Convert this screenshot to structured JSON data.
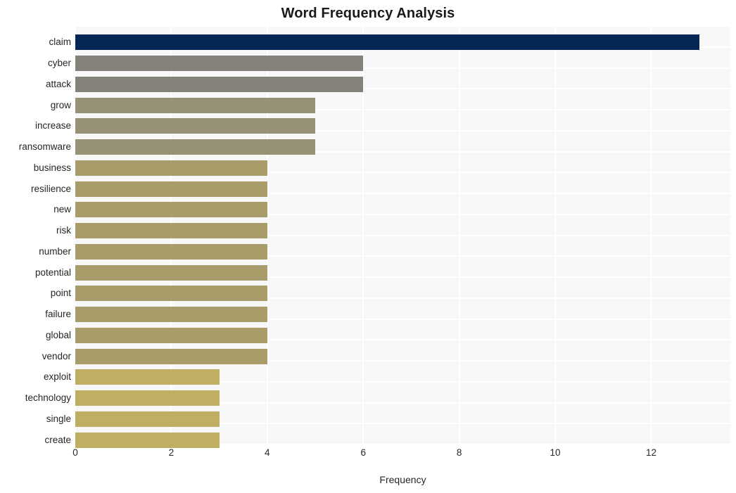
{
  "chart_data": {
    "type": "bar",
    "orientation": "horizontal",
    "title": "Word Frequency Analysis",
    "xlabel": "Frequency",
    "ylabel": "",
    "xlim": [
      0,
      13.65
    ],
    "xticks": [
      0,
      2,
      4,
      6,
      8,
      10,
      12
    ],
    "xtick_labels": [
      "0",
      "2",
      "4",
      "6",
      "8",
      "10",
      "12"
    ],
    "grid": true,
    "grid_axis": "both",
    "legend": null,
    "categories": [
      "claim",
      "cyber",
      "attack",
      "grow",
      "increase",
      "ransomware",
      "business",
      "resilience",
      "new",
      "risk",
      "number",
      "potential",
      "point",
      "failure",
      "global",
      "vendor",
      "exploit",
      "technology",
      "single",
      "create"
    ],
    "values": [
      13,
      6,
      6,
      5,
      5,
      5,
      4,
      4,
      4,
      4,
      4,
      4,
      4,
      4,
      4,
      4,
      3,
      3,
      3,
      3
    ],
    "bar_colors": [
      "#042853",
      "#85827c",
      "#85827c",
      "#979176",
      "#979176",
      "#979176",
      "#a89c6b",
      "#a89c6b",
      "#a89c6b",
      "#a89c6b",
      "#a89c6b",
      "#a89c6b",
      "#a89c6b",
      "#a89c6b",
      "#a89c6b",
      "#a89c6b",
      "#c0af62",
      "#c0af62",
      "#c0af62",
      "#c0af62"
    ]
  },
  "style": {
    "plot_background": "#f7f7f7",
    "page_background": "#ffffff",
    "gridline_color": "#ffffff",
    "text_color": "#262626",
    "title_color": "#1a1a1a"
  }
}
